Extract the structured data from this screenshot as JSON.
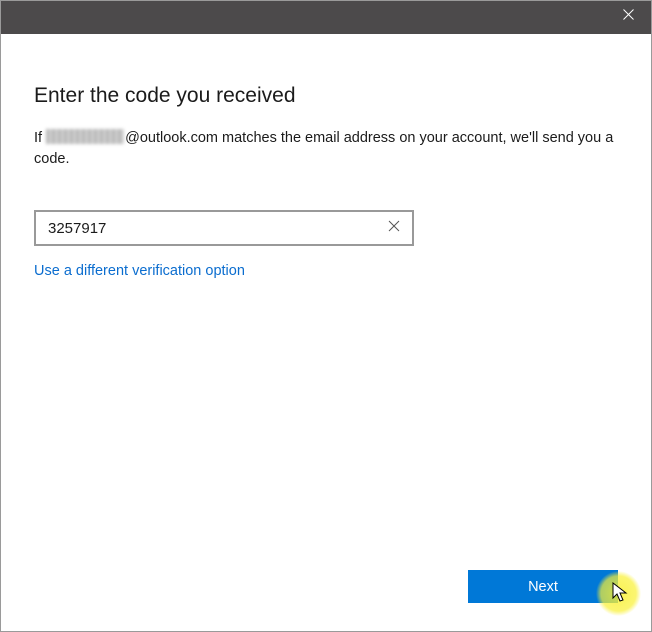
{
  "heading": "Enter the code you received",
  "description_prefix": "If ",
  "description_mid": "@outlook.com matches the email address on your account, we'll send you a code.",
  "code_value": "3257917",
  "alt_link": "Use a different verification option",
  "next_label": "Next"
}
